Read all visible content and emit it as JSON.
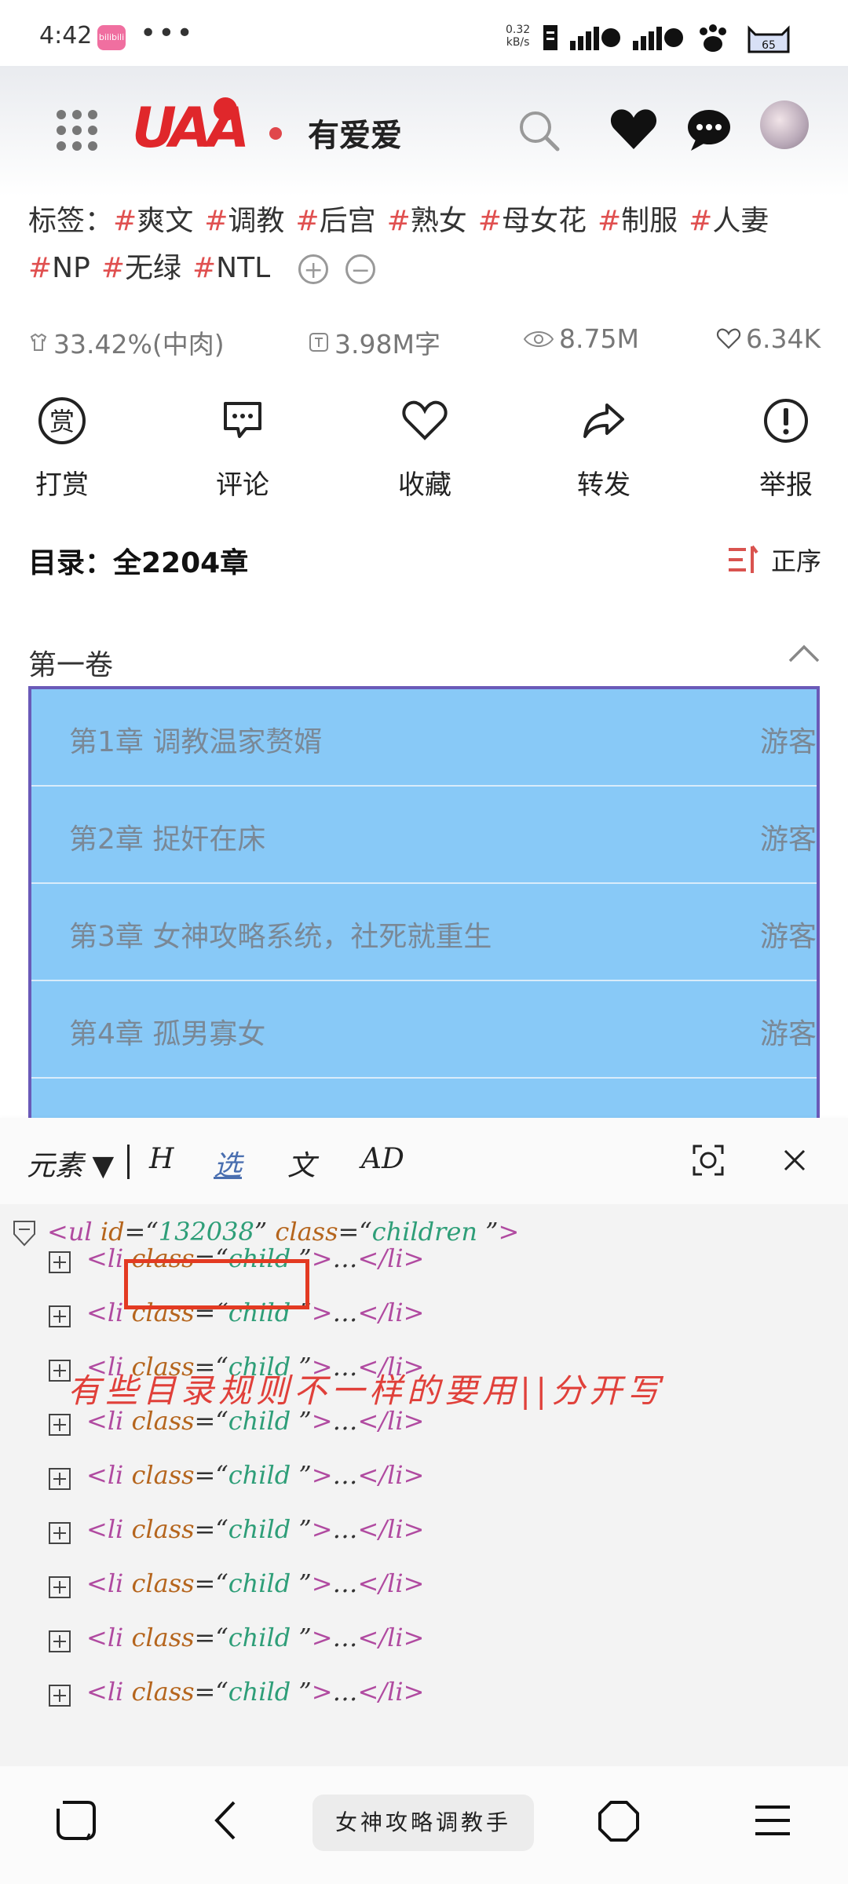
{
  "status_bar": {
    "time": "4:42",
    "app_badge": "bilibili",
    "more": "•••",
    "net_speed_value": "0.32",
    "net_speed_unit": "kB/s",
    "battery_level": "65"
  },
  "header": {
    "logo_text": "UAA",
    "app_name": "有爱爱"
  },
  "tags": {
    "label": "标签：",
    "items": [
      "爽文",
      "调教",
      "后宫",
      "熟女",
      "母女花",
      "制服",
      "人妻",
      "NP",
      "无绿",
      "NTL"
    ],
    "add_symbol": "+",
    "remove_symbol": "−"
  },
  "stats": {
    "meat": "33.42%(中肉)",
    "words": "3.98M字",
    "views": "8.75M",
    "likes": "6.34K"
  },
  "actions": {
    "tip": "打赏",
    "tip_glyph": "赏",
    "comment": "评论",
    "favorite": "收藏",
    "share": "转发",
    "report": "举报"
  },
  "toc": {
    "title": "目录：全2204章",
    "sort_label": "正序",
    "volume": "第一卷",
    "chapters": [
      {
        "title": "第1章 调教温家赘婿",
        "access": "游客"
      },
      {
        "title": "第2章 捉奸在床",
        "access": "游客"
      },
      {
        "title": "第3章 女神攻略系统，社死就重生",
        "access": "游客"
      },
      {
        "title": "第4章 孤男寡女",
        "access": "游客"
      }
    ]
  },
  "inspector": {
    "element_menu": "元素 ▼",
    "h": "H",
    "select": "选",
    "text": "文",
    "ad": "AD",
    "root": {
      "tag": "ul",
      "id": "132038",
      "class": "children "
    },
    "child": {
      "tag": "li",
      "class": "child "
    },
    "annotation": "有些目录规则不一样的要用||分开写"
  },
  "bottom_nav": {
    "url_text": "女神攻略调教手"
  },
  "colors": {
    "brand_red": "#e0272b",
    "tag_hash": "#e05050",
    "chapter_bg": "#88c9f7",
    "highlight": "#e33a22"
  }
}
